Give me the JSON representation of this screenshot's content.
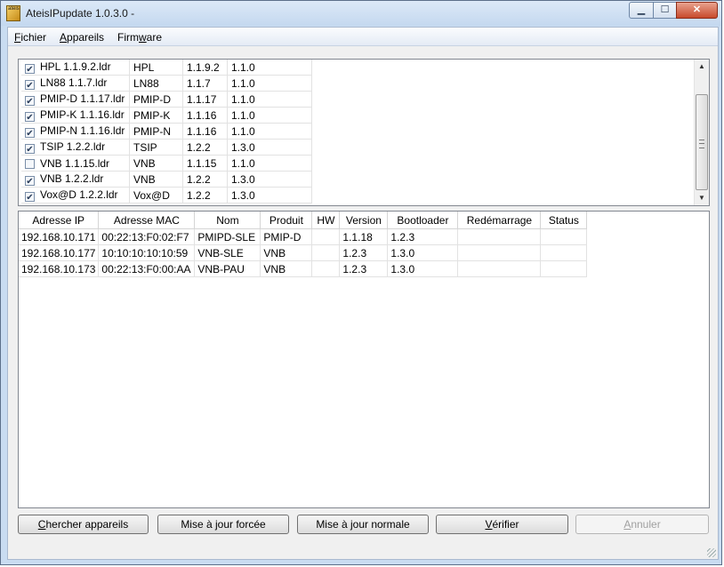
{
  "window": {
    "title": "AteisIPupdate 1.0.3.0 -",
    "icon_text": "ateis"
  },
  "controls": {
    "min": "▁",
    "max": "☐",
    "close": "✕"
  },
  "menu": [
    {
      "prefix": "",
      "mnemonic": "F",
      "rest": "ichier"
    },
    {
      "prefix": "",
      "mnemonic": "A",
      "rest": "ppareils"
    },
    {
      "prefix": "Firm",
      "mnemonic": "w",
      "rest": "are"
    }
  ],
  "firmware_list": [
    {
      "checked": true,
      "file": "HPL 1.1.9.2.ldr",
      "product": "HPL",
      "version": "1.1.9.2",
      "boot": "1.1.0"
    },
    {
      "checked": true,
      "file": "LN88 1.1.7.ldr",
      "product": "LN88",
      "version": "1.1.7",
      "boot": "1.1.0"
    },
    {
      "checked": true,
      "file": "PMIP-D 1.1.17.ldr",
      "product": "PMIP-D",
      "version": "1.1.17",
      "boot": "1.1.0"
    },
    {
      "checked": true,
      "file": "PMIP-K 1.1.16.ldr",
      "product": "PMIP-K",
      "version": "1.1.16",
      "boot": "1.1.0"
    },
    {
      "checked": true,
      "file": "PMIP-N 1.1.16.ldr",
      "product": "PMIP-N",
      "version": "1.1.16",
      "boot": "1.1.0"
    },
    {
      "checked": true,
      "file": "TSIP 1.2.2.ldr",
      "product": "TSIP",
      "version": "1.2.2",
      "boot": "1.3.0"
    },
    {
      "checked": false,
      "file": "VNB 1.1.15.ldr",
      "product": "VNB",
      "version": "1.1.15",
      "boot": "1.1.0"
    },
    {
      "checked": true,
      "file": "VNB 1.2.2.ldr",
      "product": "VNB",
      "version": "1.2.2",
      "boot": "1.3.0"
    },
    {
      "checked": true,
      "file": "Vox@D 1.2.2.ldr",
      "product": "Vox@D",
      "version": "1.2.2",
      "boot": "1.3.0"
    }
  ],
  "scroll": {
    "up": "▲",
    "down": "▼"
  },
  "devices": {
    "columns": [
      "Adresse IP",
      "Adresse MAC",
      "Nom",
      "Produit",
      "HW",
      "Version",
      "Bootloader",
      "Redémarrage",
      "Status"
    ],
    "rows": [
      [
        "192.168.10.171",
        "00:22:13:F0:02:F7",
        "PMIPD-SLE",
        "PMIP-D",
        "",
        "1.1.18",
        "1.2.3",
        "",
        ""
      ],
      [
        "192.168.10.177",
        "10:10:10:10:10:59",
        "VNB-SLE",
        "VNB",
        "",
        "1.2.3",
        "1.3.0",
        "",
        ""
      ],
      [
        "192.168.10.173",
        "00:22:13:F0:00:AA",
        "VNB-PAU",
        "VNB",
        "",
        "1.2.3",
        "1.3.0",
        "",
        ""
      ]
    ]
  },
  "buttons": {
    "search": {
      "mnemonic": "C",
      "rest": "hercher appareils"
    },
    "forced": {
      "label": "Mise à jour forcée"
    },
    "normal": {
      "label": "Mise à jour normale"
    },
    "verify": {
      "mnemonic": "V",
      "rest": "érifier"
    },
    "cancel": {
      "mnemonic": "A",
      "rest": "nnuler",
      "enabled": false
    }
  }
}
